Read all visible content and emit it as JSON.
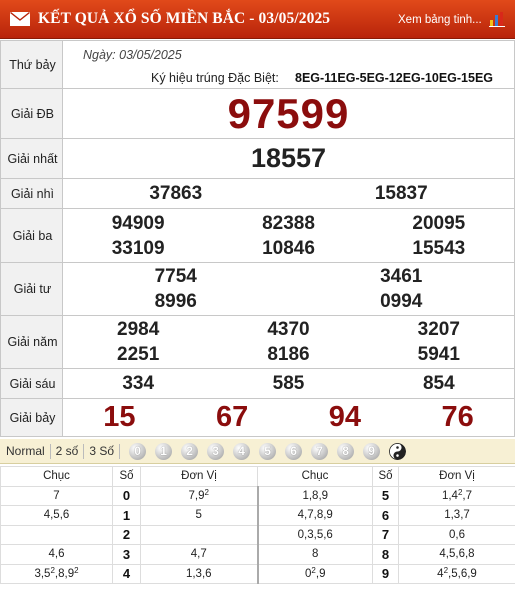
{
  "header": {
    "title": "KẾT QUẢ XỔ SỐ MIỀN BẮC - 03/05/2025",
    "link_text": "Xem bảng tinh...",
    "mail_icon": "mail-icon",
    "chart_icon": "bar-chart-icon"
  },
  "meta": {
    "day": "Thứ bảy",
    "date_text": "Ngày: 03/05/2025",
    "kyhieu_label": "Ký hiệu trúng Đặc Biệt:",
    "kyhieu_value": "8EG-11EG-5EG-12EG-10EG-15EG"
  },
  "prizes": {
    "db": {
      "label": "Giải ĐB",
      "numbers": [
        "97599"
      ]
    },
    "nhat": {
      "label": "Giải nhất",
      "numbers": [
        "18557"
      ]
    },
    "nhi": {
      "label": "Giải nhì",
      "numbers": [
        "37863",
        "15837"
      ]
    },
    "ba": {
      "label": "Giải ba",
      "numbers": [
        "94909",
        "82388",
        "20095",
        "33109",
        "10846",
        "15543"
      ]
    },
    "tu": {
      "label": "Giải tư",
      "numbers": [
        "7754",
        "3461",
        "8996",
        "0994"
      ]
    },
    "nam": {
      "label": "Giải năm",
      "numbers": [
        "2984",
        "4370",
        "3207",
        "2251",
        "8186",
        "5941"
      ]
    },
    "sau": {
      "label": "Giải sáu",
      "numbers": [
        "334",
        "585",
        "854"
      ]
    },
    "bay": {
      "label": "Giải bảy",
      "numbers": [
        "15",
        "67",
        "94",
        "76"
      ]
    }
  },
  "filters": {
    "buttons": [
      "Normal",
      "2 số",
      "3 Số"
    ],
    "digits": [
      "0",
      "1",
      "2",
      "3",
      "4",
      "5",
      "6",
      "7",
      "8",
      "9"
    ],
    "extra_icon": "yin-yang-icon"
  },
  "loto": {
    "headers": [
      "Chục",
      "Số",
      "Đơn Vị",
      "Chục",
      "Số",
      "Đơn Vị"
    ],
    "left": [
      {
        "chuc": "7",
        "so": "0",
        "donvi_html": "7,9<sup>2</sup>"
      },
      {
        "chuc": "4,5,6",
        "so": "1",
        "donvi_html": "5"
      },
      {
        "chuc": "",
        "so": "2",
        "donvi_html": ""
      },
      {
        "chuc": "4,6",
        "so": "3",
        "donvi_html": "4,7"
      },
      {
        "chuc_html": "3,5<sup>2</sup>,8,9<sup>2</sup>",
        "so": "4",
        "donvi_html": "1,3,6"
      }
    ],
    "right": [
      {
        "chuc": "1,8,9",
        "so": "5",
        "donvi_html": "1,4<sup>2</sup>,7"
      },
      {
        "chuc": "4,7,8,9",
        "so": "6",
        "donvi_html": "1,3,7"
      },
      {
        "chuc": "0,3,5,6",
        "so": "7",
        "donvi_html": "0,6"
      },
      {
        "chuc": "8",
        "so": "8",
        "donvi_html": "4,5,6,8"
      },
      {
        "chuc_html": "0<sup>2</sup>,9",
        "so": "9",
        "donvi_html": "4<sup>2</sup>,5,6,9"
      }
    ]
  },
  "colors": {
    "header_bg": "#c9300f",
    "special_red": "#8b0d0d",
    "filter_bg": "#f7f0d4"
  }
}
